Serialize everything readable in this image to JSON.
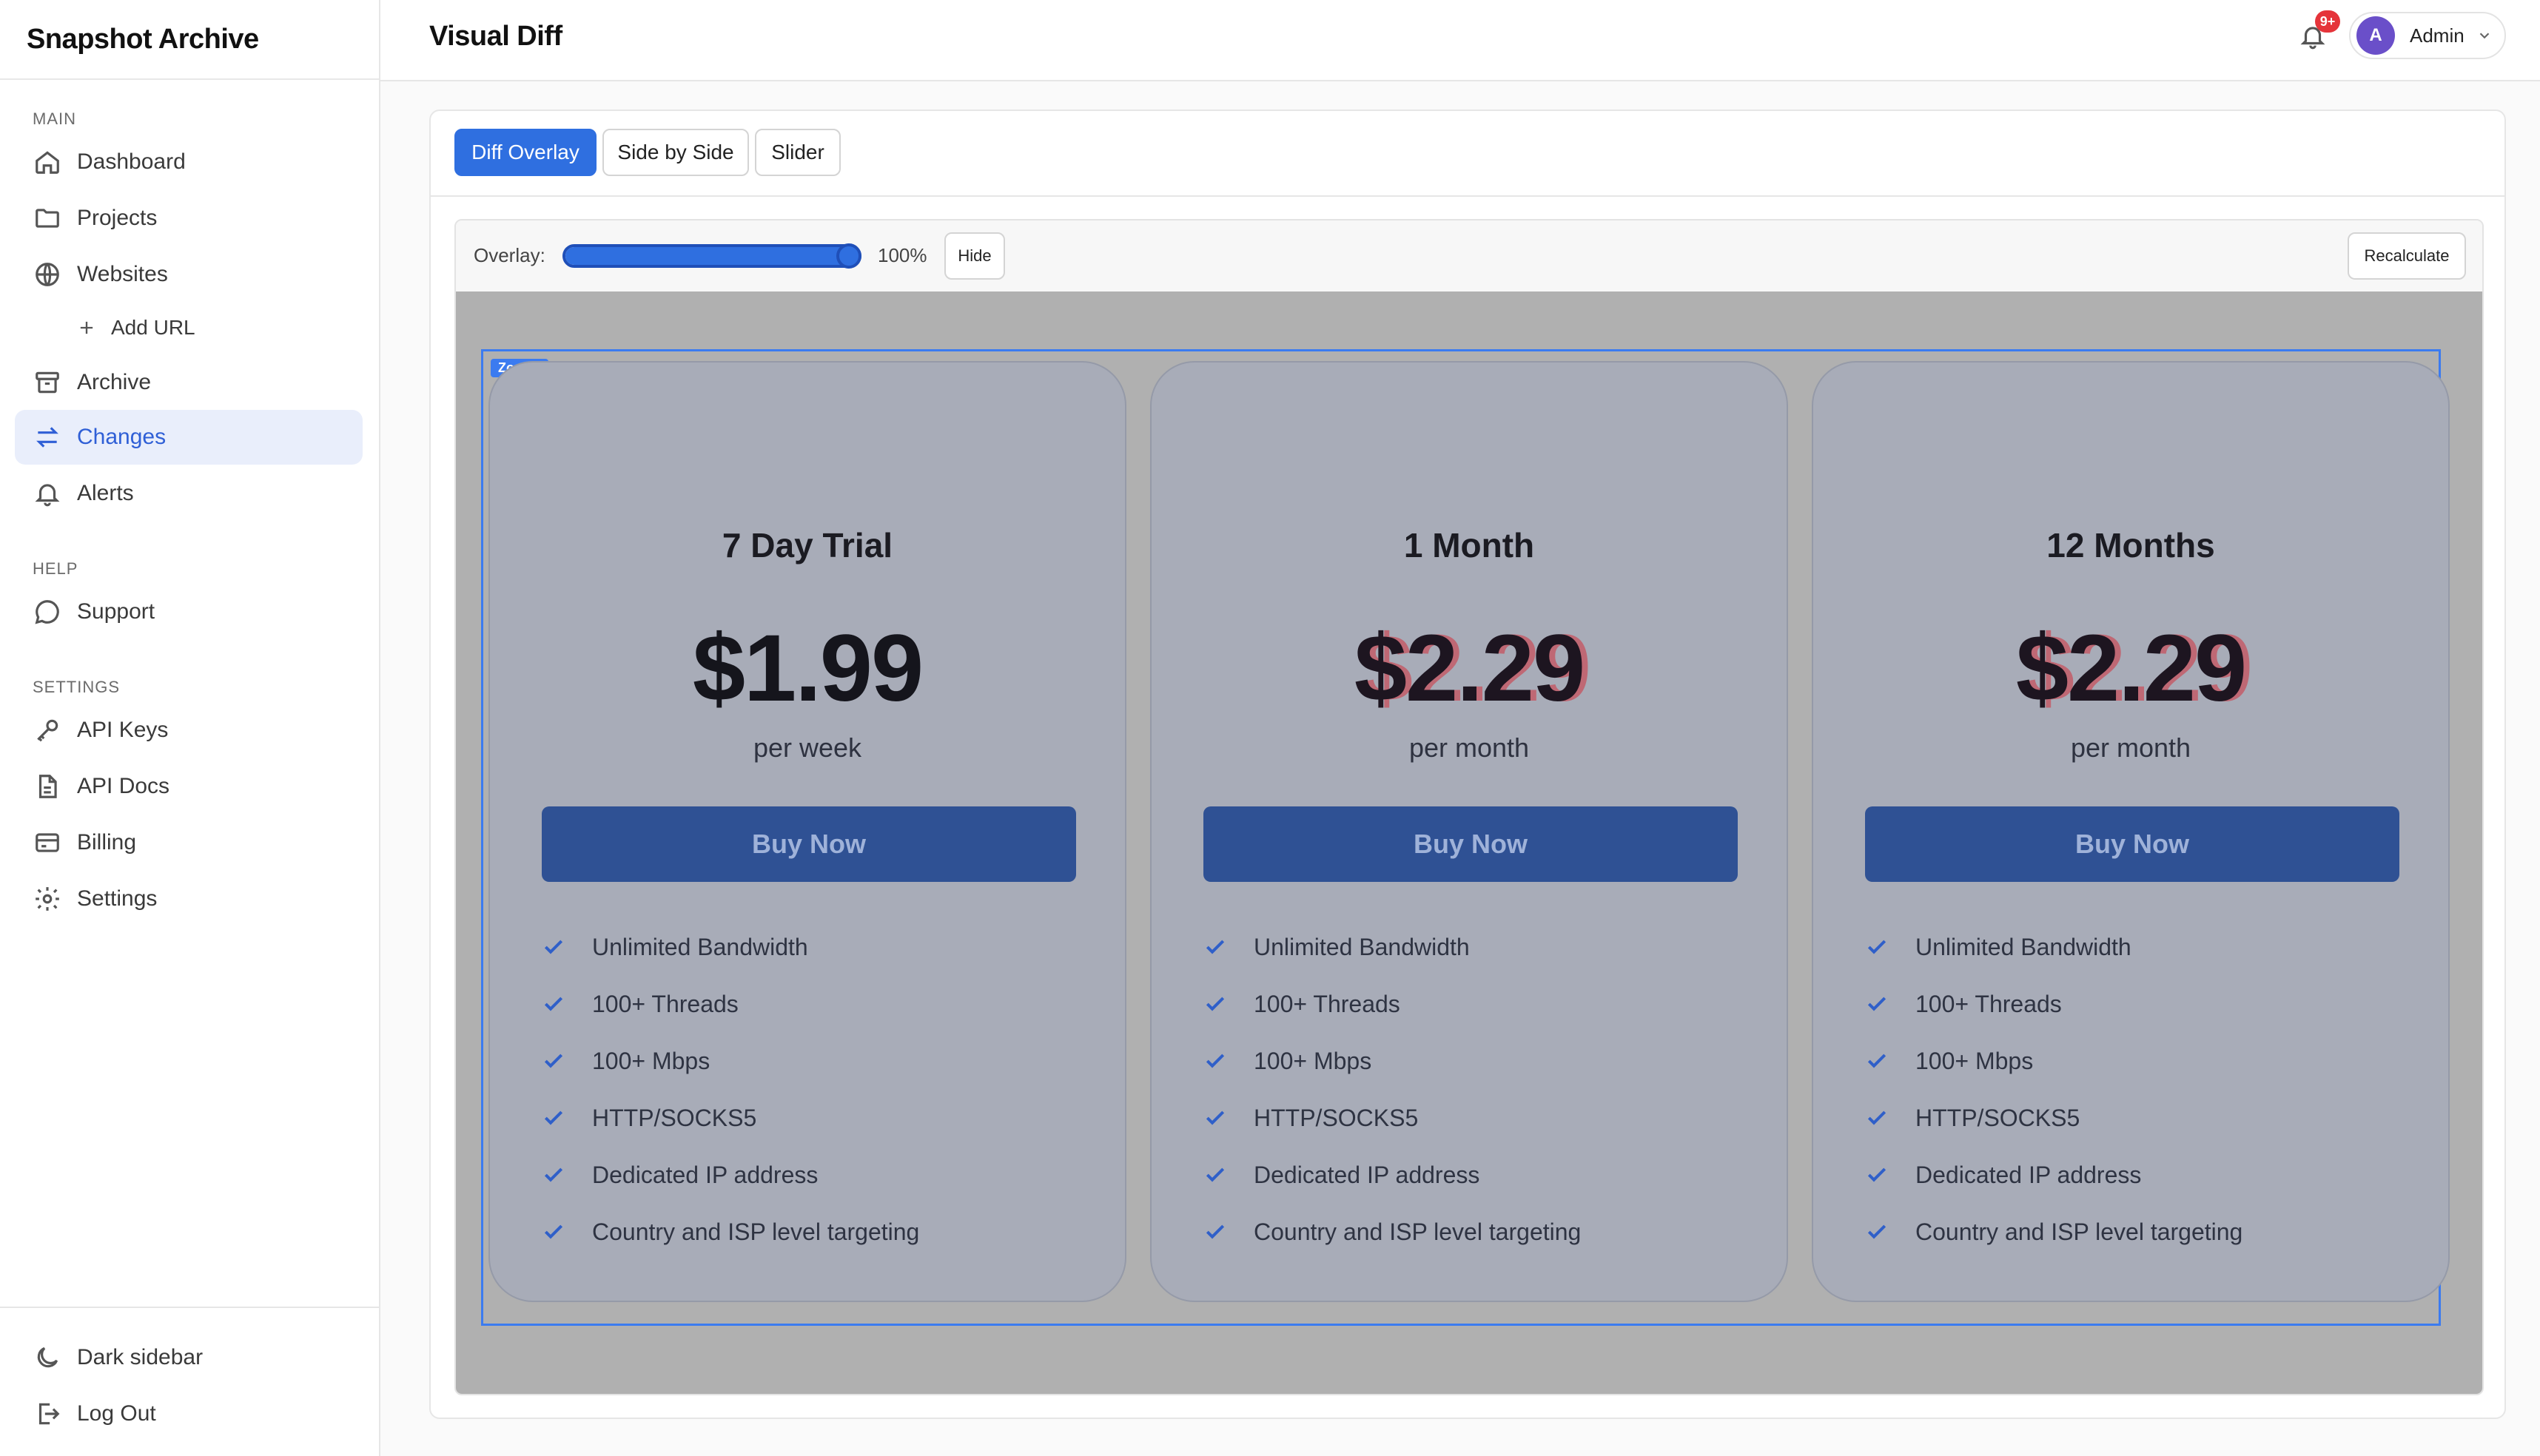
{
  "sidebar": {
    "brand": "Snapshot Archive",
    "sections": {
      "main": "MAIN",
      "help": "HELP",
      "settings": "SETTINGS"
    },
    "items": {
      "dashboard": "Dashboard",
      "projects": "Projects",
      "websites": "Websites",
      "add_url": "Add URL",
      "archive": "Archive",
      "changes": "Changes",
      "alerts": "Alerts",
      "support": "Support",
      "api_keys": "API Keys",
      "api_docs": "API Docs",
      "billing": "Billing",
      "settings": "Settings"
    },
    "active_item": "Changes",
    "bottom": {
      "dark_sidebar": "Dark sidebar",
      "log_out": "Log Out"
    }
  },
  "header": {
    "title": "Visual Diff",
    "notifications_badge": "9+",
    "user": {
      "initial": "A",
      "name": "Admin"
    }
  },
  "diff": {
    "tabs": [
      "Diff Overlay",
      "Side by Side",
      "Slider"
    ],
    "active_tab": "Diff Overlay",
    "overlay_label": "Overlay:",
    "overlay_value": 1.0,
    "overlay_text": "100%",
    "hide_label": "Hide",
    "recalculate_label": "Recalculate",
    "zone_label": "Zone 1"
  },
  "plans": [
    {
      "name": "7 Day Trial",
      "price": "$1.99",
      "period": "per week",
      "button": "Buy Now",
      "features": [
        "Unlimited Bandwidth",
        "100+ Threads",
        "100+ Mbps",
        "HTTP/SOCKS5",
        "Dedicated IP address",
        "Country and ISP level targeting"
      ]
    },
    {
      "name": "1 Month",
      "price": "$2.29",
      "period": "per month",
      "button": "Buy Now",
      "features": [
        "Unlimited Bandwidth",
        "100+ Threads",
        "100+ Mbps",
        "HTTP/SOCKS5",
        "Dedicated IP address",
        "Country and ISP level targeting"
      ]
    },
    {
      "name": "12 Months",
      "price": "$2.29",
      "period": "per month",
      "button": "Buy Now",
      "features": [
        "Unlimited Bandwidth",
        "100+ Threads",
        "100+ Mbps",
        "HTTP/SOCKS5",
        "Dedicated IP address",
        "Country and ISP level targeting"
      ]
    }
  ],
  "icons": {
    "dashboard": "home-icon",
    "projects": "folder-icon",
    "websites": "globe-icon",
    "add_url": "plus-icon",
    "archive": "archive-box-icon",
    "changes": "arrows-swap-icon",
    "alerts": "bell-icon",
    "support": "chat-bubble-icon",
    "api_keys": "key-icon",
    "api_docs": "document-icon",
    "billing": "credit-card-icon",
    "settings": "gear-icon",
    "dark_sidebar": "moon-icon",
    "log_out": "logout-icon",
    "notifications": "bell-icon",
    "user_menu": "chevron-down-icon",
    "feature": "check-icon"
  },
  "colors": {
    "accent": "#2f6fe0",
    "active_nav_bg": "#e9eefb",
    "zone_border": "#3b7bf0",
    "badge": "#e5343a",
    "avatar": "#6a4fc9",
    "buy_button": "#2f5194"
  }
}
